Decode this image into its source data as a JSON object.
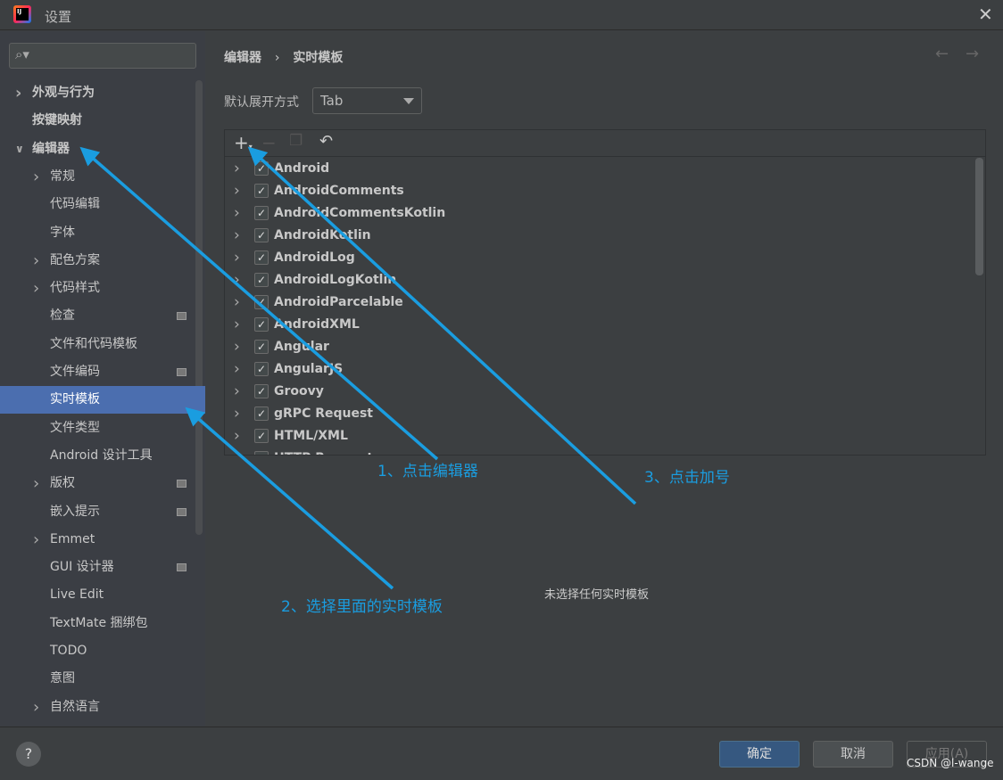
{
  "window": {
    "title": "设置"
  },
  "sidebar": {
    "items": [
      {
        "label": "外观与行为",
        "level": 0,
        "arrow": "right",
        "bold": true
      },
      {
        "label": "按键映射",
        "level": 0,
        "bold": true
      },
      {
        "label": "编辑器",
        "level": 0,
        "arrow": "down",
        "bold": true
      },
      {
        "label": "常规",
        "level": 1,
        "arrow": "right"
      },
      {
        "label": "代码编辑",
        "level": 1
      },
      {
        "label": "字体",
        "level": 1
      },
      {
        "label": "配色方案",
        "level": 1,
        "arrow": "right"
      },
      {
        "label": "代码样式",
        "level": 1,
        "arrow": "right"
      },
      {
        "label": "检查",
        "level": 1,
        "badge": true
      },
      {
        "label": "文件和代码模板",
        "level": 1
      },
      {
        "label": "文件编码",
        "level": 1,
        "badge": true
      },
      {
        "label": "实时模板",
        "level": 1,
        "selected": true
      },
      {
        "label": "文件类型",
        "level": 1
      },
      {
        "label": "Android 设计工具",
        "level": 1
      },
      {
        "label": "版权",
        "level": 1,
        "arrow": "right",
        "badge": true
      },
      {
        "label": "嵌入提示",
        "level": 1,
        "badge": true
      },
      {
        "label": "Emmet",
        "level": 1,
        "arrow": "right"
      },
      {
        "label": "GUI 设计器",
        "level": 1,
        "badge": true
      },
      {
        "label": "Live Edit",
        "level": 1
      },
      {
        "label": "TextMate 捆绑包",
        "level": 1
      },
      {
        "label": "TODO",
        "level": 1
      },
      {
        "label": "意图",
        "level": 1
      },
      {
        "label": "自然语言",
        "level": 1,
        "arrow": "right"
      }
    ]
  },
  "breadcrumb": {
    "parent": "编辑器",
    "sep": "›",
    "current": "实时模板"
  },
  "expand": {
    "label": "默认展开方式",
    "value": "Tab"
  },
  "templates": [
    "Android",
    "AndroidComments",
    "AndroidCommentsKotlin",
    "AndroidKotlin",
    "AndroidLog",
    "AndroidLogKotlin",
    "AndroidParcelable",
    "AndroidXML",
    "Angular",
    "AngularJS",
    "Groovy",
    "gRPC Request",
    "HTML/XML",
    "HTTP Request"
  ],
  "empty_text": "未选择任何实时模板",
  "buttons": {
    "ok": "确定",
    "cancel": "取消",
    "apply": "应用(A)",
    "help": "?"
  },
  "annotations": {
    "step1": "1、点击编辑器",
    "step2": "2、选择里面的实时模板",
    "step3": "3、点击加号",
    "color": "#1a9de0"
  },
  "watermark": "CSDN @l-wange",
  "colors": {
    "selection": "#4b6eaf",
    "ok_button": "#365880"
  }
}
